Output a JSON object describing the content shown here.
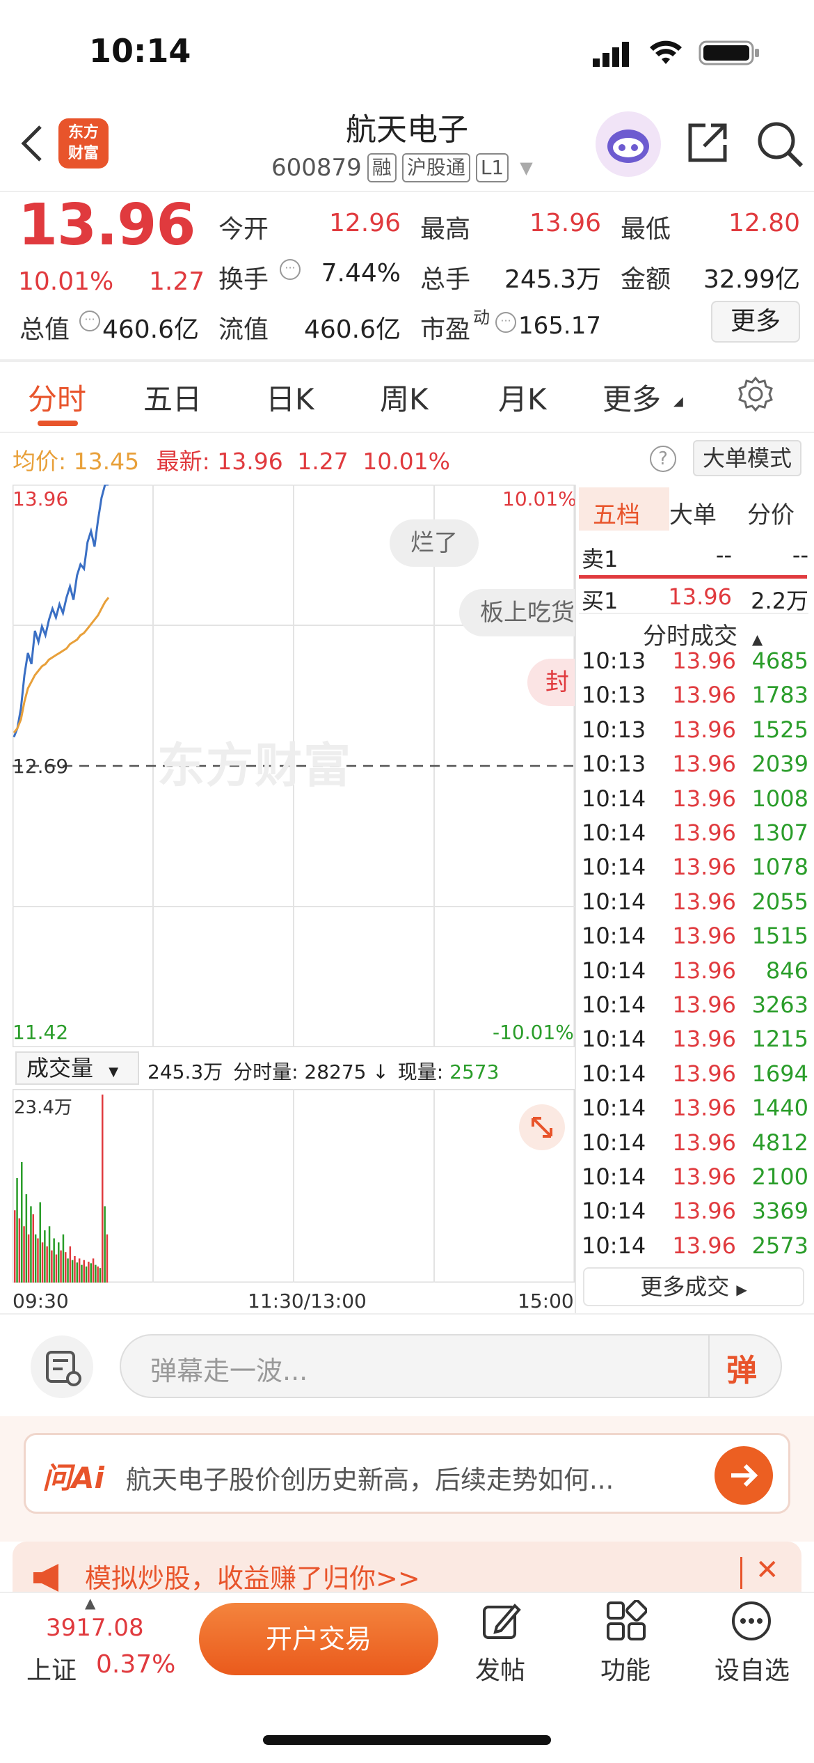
{
  "status_bar": {
    "time": "10:14"
  },
  "header": {
    "logo_text_1": "东方",
    "logo_text_2": "财富",
    "title": "航天电子",
    "code": "600879",
    "tags": [
      "融",
      "沪股通",
      "L1"
    ]
  },
  "quote": {
    "price": "13.96",
    "change_pct": "10.01%",
    "change": "1.27",
    "stats": [
      {
        "label": "今开",
        "value": "12.96"
      },
      {
        "label": "最高",
        "value": "13.96"
      },
      {
        "label": "最低",
        "value": "12.80"
      },
      {
        "label": "换手",
        "value": "7.44%"
      },
      {
        "label": "总手",
        "value": "245.3万"
      },
      {
        "label": "金额",
        "value": "32.99亿"
      },
      {
        "label": "总值",
        "value": "460.6亿"
      },
      {
        "label": "流值",
        "value": "460.6亿"
      },
      {
        "label": "市盈",
        "label_sup": "动",
        "value": "165.17"
      }
    ],
    "more_label": "更多"
  },
  "tabs": [
    "分时",
    "五日",
    "日K",
    "周K",
    "月K",
    "更多"
  ],
  "info_row": {
    "avg_label": "均价:",
    "avg_value": "13.45",
    "latest_label": "最新:",
    "latest_value": "13.96",
    "latest_change": "1.27",
    "latest_pct": "10.01%",
    "help": "?",
    "big_order_mode": "大单模式"
  },
  "chart_labels": {
    "top_price": "13.96",
    "top_pct": "10.01%",
    "mid_price": "12.69",
    "bottom_price": "11.42",
    "bottom_pct": "-10.01%",
    "watermark": "东方财富",
    "volume_selector": "成交量",
    "volume_total": "245.3万",
    "minute_vol_label": "分时量:",
    "minute_vol_value": "28275",
    "minute_vol_arrow": "↓",
    "current_vol_label": "现量:",
    "current_vol_value": "2573",
    "volume_max": "23.4万",
    "x_start": "09:30",
    "x_mid": "11:30/13:00",
    "x_end": "15:00"
  },
  "danmu": [
    "烂了",
    "板上吃货",
    "封"
  ],
  "chart_data": {
    "type": "line",
    "x_range": [
      "09:30",
      "15:00"
    ],
    "ylim": [
      11.42,
      13.96
    ],
    "reference": 12.69,
    "series": [
      {
        "values": [
          12.82,
          12.86,
          12.95,
          13.1,
          13.2,
          13.15,
          13.3,
          13.25,
          13.32,
          13.28,
          13.35,
          13.4,
          13.36,
          13.42,
          13.38,
          13.45,
          13.5,
          13.44,
          13.55,
          13.6,
          13.58,
          13.7,
          13.75,
          13.68,
          13.8,
          13.9,
          13.96,
          13.96
        ]
      },
      {
        "values": [
          12.84,
          12.86,
          12.9,
          12.98,
          13.04,
          13.07,
          13.1,
          13.12,
          13.14,
          13.15,
          13.17,
          13.18,
          13.19,
          13.2,
          13.21,
          13.22,
          13.24,
          13.25,
          13.26,
          13.28,
          13.29,
          13.31,
          13.33,
          13.35,
          13.37,
          13.4,
          13.43,
          13.45
        ]
      }
    ],
    "volume": {
      "ylim": [
        0,
        234000
      ],
      "values": [
        90000,
        130000,
        80000,
        150000,
        70000,
        110000,
        60000,
        95000,
        85000,
        60000,
        55000,
        100000,
        50000,
        65000,
        45000,
        70000,
        40000,
        55000,
        35000,
        50000,
        40000,
        60000,
        38000,
        30000,
        45000,
        28000,
        33000,
        25000,
        30000,
        22000,
        28000,
        20000,
        26000,
        24000,
        30000,
        22000,
        20000,
        18000,
        234000,
        95000,
        60000
      ]
    }
  },
  "right_panel": {
    "tabs": [
      "五档",
      "大单",
      "分价"
    ],
    "sell1": {
      "label": "卖1",
      "price": "--",
      "vol": "--"
    },
    "buy1": {
      "label": "买1",
      "price": "13.96",
      "vol": "2.2万"
    },
    "trades_title": "分时成交",
    "trades": [
      {
        "t": "10:13",
        "p": "13.96",
        "v": "4685"
      },
      {
        "t": "10:13",
        "p": "13.96",
        "v": "1783"
      },
      {
        "t": "10:13",
        "p": "13.96",
        "v": "1525"
      },
      {
        "t": "10:13",
        "p": "13.96",
        "v": "2039"
      },
      {
        "t": "10:14",
        "p": "13.96",
        "v": "1008"
      },
      {
        "t": "10:14",
        "p": "13.96",
        "v": "1307"
      },
      {
        "t": "10:14",
        "p": "13.96",
        "v": "1078"
      },
      {
        "t": "10:14",
        "p": "13.96",
        "v": "2055"
      },
      {
        "t": "10:14",
        "p": "13.96",
        "v": "1515"
      },
      {
        "t": "10:14",
        "p": "13.96",
        "v": "846"
      },
      {
        "t": "10:14",
        "p": "13.96",
        "v": "3263"
      },
      {
        "t": "10:14",
        "p": "13.96",
        "v": "1215"
      },
      {
        "t": "10:14",
        "p": "13.96",
        "v": "1694"
      },
      {
        "t": "10:14",
        "p": "13.96",
        "v": "1440"
      },
      {
        "t": "10:14",
        "p": "13.96",
        "v": "4812"
      },
      {
        "t": "10:14",
        "p": "13.96",
        "v": "2100"
      },
      {
        "t": "10:14",
        "p": "13.96",
        "v": "3369"
      },
      {
        "t": "10:14",
        "p": "13.96",
        "v": "2573"
      }
    ],
    "more_trades": "更多成交"
  },
  "danmu_bar": {
    "placeholder": "弹幕走一波...",
    "send_label": "弹"
  },
  "ai": {
    "brand": "问Ai",
    "question": "航天电子股价创历史新高，后续走势如何..."
  },
  "promo": {
    "text": "模拟炒股，收益赚了归你>>"
  },
  "bottom": {
    "index_value": "3917.08",
    "index_name": "上证",
    "index_pct": "0.37%",
    "open_trade": "开户交易",
    "nav": [
      "发帖",
      "功能",
      "设自选"
    ]
  },
  "colors": {
    "up": "#e03a3e",
    "down": "#2a9d2a",
    "accent": "#e8542b",
    "avg_line": "#e8a03a",
    "price_line": "#3a6fc4"
  }
}
